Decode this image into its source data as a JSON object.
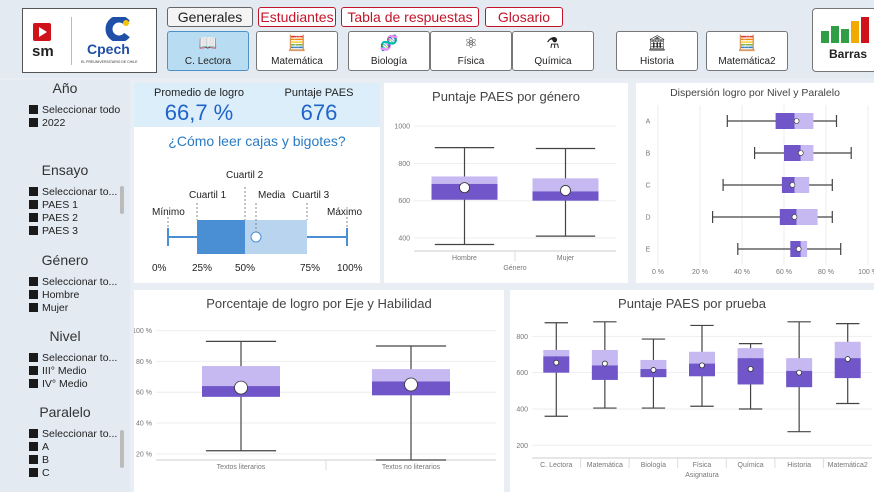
{
  "header": {
    "logo": {
      "sm": "sm",
      "cpech": "Cpech",
      "tagline": "EL PREUNIVERSITARIO DE CHILE"
    },
    "nav_tabs": [
      {
        "label": "Generales",
        "style": "normal"
      },
      {
        "label": "Estudiantes",
        "style": "red"
      },
      {
        "label": "Tabla de respuestas",
        "style": "red"
      },
      {
        "label": "Glosario",
        "style": "red"
      }
    ],
    "subjects": [
      {
        "label": "C. Lectora",
        "icon": "book-icon",
        "glyph": "📖",
        "active": true
      },
      {
        "label": "Matemática",
        "icon": "calculator-icon",
        "glyph": "🧮",
        "active": false
      },
      {
        "label": "Biología",
        "icon": "dna-icon",
        "glyph": "🧬",
        "active": false
      },
      {
        "label": "Física",
        "icon": "atom-icon",
        "glyph": "⚛",
        "active": false
      },
      {
        "label": "Química",
        "icon": "flask-icon",
        "glyph": "⚗",
        "active": false
      },
      {
        "label": "Historia",
        "icon": "colosseum-icon",
        "glyph": "🏛",
        "active": false
      },
      {
        "label": "Matemática2",
        "icon": "calculator-icon",
        "glyph": "🧮",
        "active": false
      }
    ],
    "barras_label": "Barras"
  },
  "sidebar": {
    "anio": {
      "title": "Año",
      "options": [
        "Seleccionar todo",
        "2022"
      ]
    },
    "ensayo": {
      "title": "Ensayo",
      "options": [
        "Seleccionar to...",
        "PAES 1",
        "PAES 2",
        "PAES 3"
      ]
    },
    "genero": {
      "title": "Género",
      "options": [
        "Seleccionar to...",
        "Hombre",
        "Mujer"
      ]
    },
    "nivel": {
      "title": "Nivel",
      "options": [
        "Seleccionar to...",
        "III° Medio",
        "IV° Medio"
      ]
    },
    "paralelo": {
      "title": "Paralelo",
      "options": [
        "Seleccionar to...",
        "A",
        "B",
        "C"
      ]
    }
  },
  "kpis": {
    "logro_label": "Promedio de logro",
    "logro_value": "66,7 %",
    "paes_label": "Puntaje PAES",
    "paes_value": "676"
  },
  "guide": {
    "title": "¿Cómo leer cajas y bigotes?",
    "cuartil2": "Cuartil 2",
    "cuartil1": "Cuartil 1",
    "media": "Media",
    "cuartil3": "Cuartil 3",
    "minimo": "Mínimo",
    "maximo": "Máximo",
    "ticks": [
      "0%",
      "25%",
      "50%",
      "75%",
      "100%"
    ]
  },
  "colors": {
    "box_dark": "#7056c8",
    "box_light": "#c6b8f0",
    "whisker": "#444444",
    "accent_blue": "#1f64c7",
    "red": "#c3152a"
  },
  "chart_data": [
    {
      "type": "box",
      "title": "Puntaje PAES por género",
      "xlabel": "Género",
      "ylabel": "",
      "ylim": [
        330,
        1060
      ],
      "yticks": [
        400,
        600,
        800,
        1000
      ],
      "categories": [
        "Hombre",
        "Mujer"
      ],
      "stats": [
        {
          "min": 365,
          "q1": 605,
          "median": 690,
          "q3": 730,
          "max": 885,
          "mean": 670
        },
        {
          "min": 410,
          "q1": 600,
          "median": 650,
          "q3": 720,
          "max": 880,
          "mean": 655
        }
      ]
    },
    {
      "type": "box",
      "title": "Dispersión logro por Nivel y Paralelo",
      "orientation": "horizontal",
      "xlim": [
        0,
        100
      ],
      "xticks": [
        "0 %",
        "20 %",
        "40 %",
        "60 %",
        "80 %",
        "100 %"
      ],
      "categories": [
        "A",
        "B",
        "C",
        "D",
        "E"
      ],
      "stats": [
        {
          "min": 33,
          "q1": 56,
          "median": 65,
          "q3": 74,
          "max": 85,
          "mean": 66
        },
        {
          "min": 46,
          "q1": 60,
          "median": 68,
          "q3": 74,
          "max": 92,
          "mean": 68
        },
        {
          "min": 31,
          "q1": 59,
          "median": 65,
          "q3": 72,
          "max": 83,
          "mean": 64
        },
        {
          "min": 26,
          "q1": 58,
          "median": 66,
          "q3": 76,
          "max": 83,
          "mean": 65
        },
        {
          "min": 38,
          "q1": 63,
          "median": 68,
          "q3": 71,
          "max": 87,
          "mean": 67
        }
      ]
    },
    {
      "type": "box",
      "title": "Porcentaje de logro por Eje y Habilidad",
      "ylim": [
        16,
        103
      ],
      "yticks": [
        "20 %",
        "40 %",
        "60 %",
        "80 %",
        "100 %"
      ],
      "ytick_values": [
        20,
        40,
        60,
        80,
        100
      ],
      "categories": [
        "Textos literarios",
        "Textos no literarios"
      ],
      "stats": [
        {
          "min": 22,
          "q1": 57,
          "median": 64,
          "q3": 77,
          "max": 93,
          "mean": 63
        },
        {
          "min": 16,
          "q1": 58,
          "median": 67,
          "q3": 75,
          "max": 90,
          "mean": 65
        }
      ]
    },
    {
      "type": "box",
      "title": "Puntaje PAES por prueba",
      "xlabel": "Asignatura",
      "ylim": [
        130,
        890
      ],
      "yticks": [
        200,
        400,
        600,
        800
      ],
      "categories": [
        "C. Lectora",
        "Matemática",
        "Biología",
        "Física",
        "Química",
        "Historia",
        "Matemática2"
      ],
      "stats": [
        {
          "min": 360,
          "q1": 600,
          "median": 690,
          "q3": 725,
          "max": 875,
          "mean": 655
        },
        {
          "min": 405,
          "q1": 560,
          "median": 640,
          "q3": 725,
          "max": 880,
          "mean": 650
        },
        {
          "min": 405,
          "q1": 575,
          "median": 620,
          "q3": 670,
          "max": 785,
          "mean": 615
        },
        {
          "min": 415,
          "q1": 580,
          "median": 650,
          "q3": 715,
          "max": 860,
          "mean": 640
        },
        {
          "min": 400,
          "q1": 535,
          "median": 680,
          "q3": 735,
          "max": 760,
          "mean": 620
        },
        {
          "min": 275,
          "q1": 520,
          "median": 610,
          "q3": 680,
          "max": 880,
          "mean": 600
        },
        {
          "min": 430,
          "q1": 570,
          "median": 680,
          "q3": 770,
          "max": 870,
          "mean": 675
        }
      ]
    }
  ]
}
